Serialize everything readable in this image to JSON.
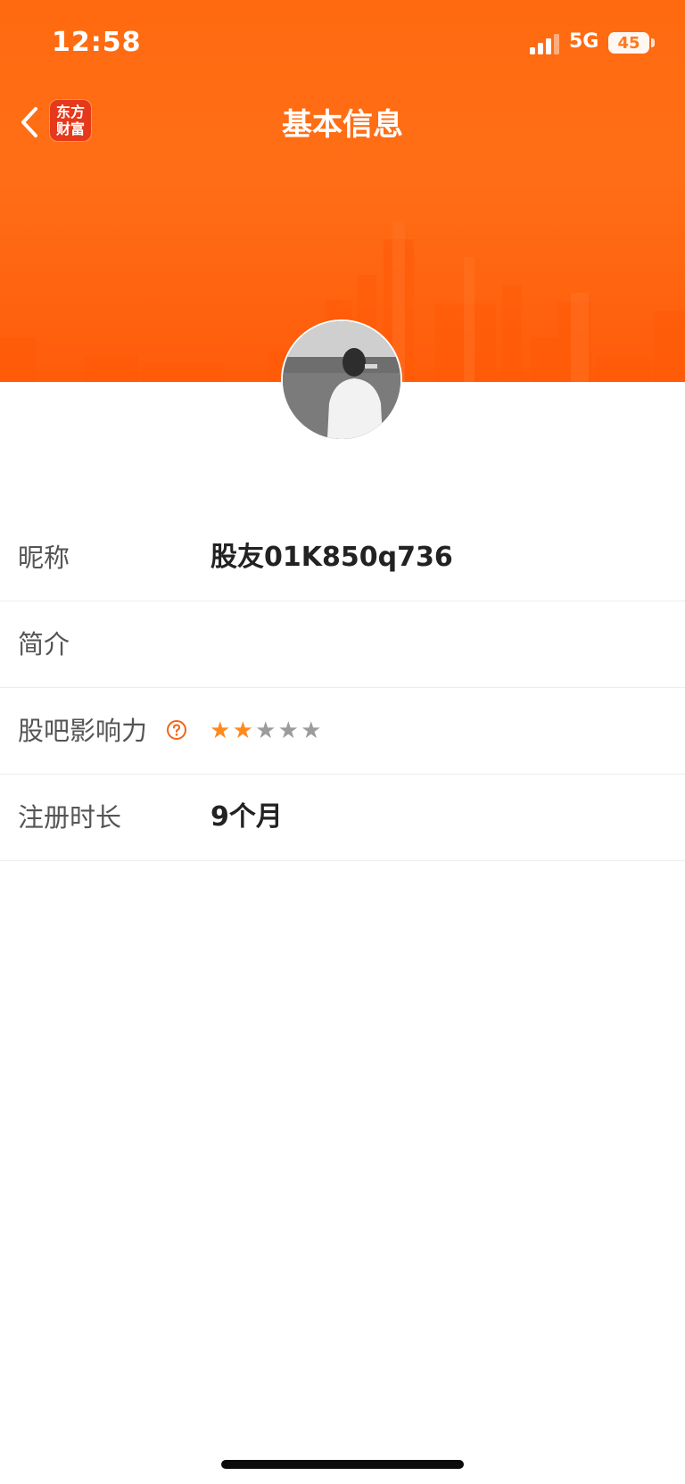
{
  "status_bar": {
    "time": "12:58",
    "network": "5G",
    "battery": "45"
  },
  "nav": {
    "title": "基本信息",
    "back_icon": "chevron-left-icon",
    "logo_line1": "东方",
    "logo_line2": "财富"
  },
  "colors": {
    "accent": "#ff6a10",
    "star_on": "#ff8a1d",
    "star_off": "#9c9c9c",
    "logo_bg": "#e6391b"
  },
  "profile": {
    "rows": [
      {
        "label": "昵称",
        "value": "股友01K850q736"
      },
      {
        "label": "简介",
        "value": ""
      },
      {
        "label": "股吧影响力",
        "rating": 2,
        "max_rating": 5,
        "help_icon": "question-circle-icon"
      },
      {
        "label": "注册时长",
        "value": "9个月"
      }
    ]
  }
}
